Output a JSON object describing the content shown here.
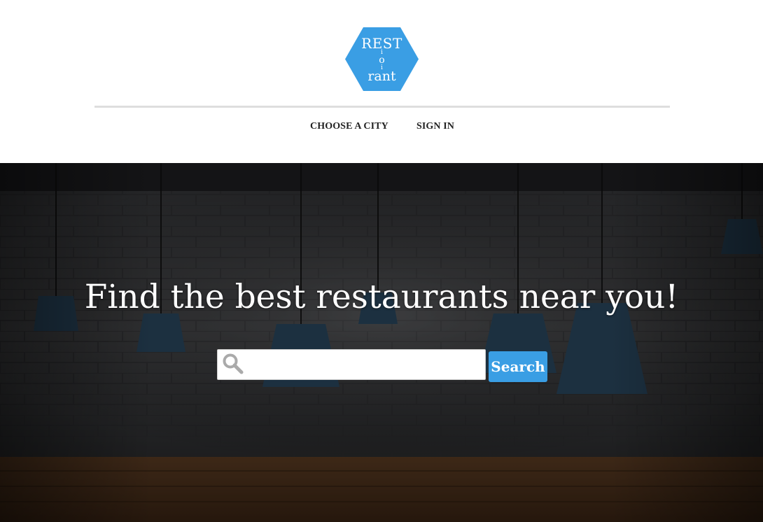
{
  "logo": {
    "top": "REST",
    "mid_bar": "i",
    "mid": "o",
    "bottom": "rant",
    "color": "#3a9ee4"
  },
  "nav": {
    "items": [
      {
        "label": "CHOOSE A CITY"
      },
      {
        "label": "SIGN IN"
      }
    ]
  },
  "hero": {
    "title": "Find the best restaurants near you!",
    "search": {
      "value": "",
      "placeholder": "",
      "icon": "search-icon",
      "button_label": "Search",
      "button_color": "#3a9ee4"
    }
  }
}
